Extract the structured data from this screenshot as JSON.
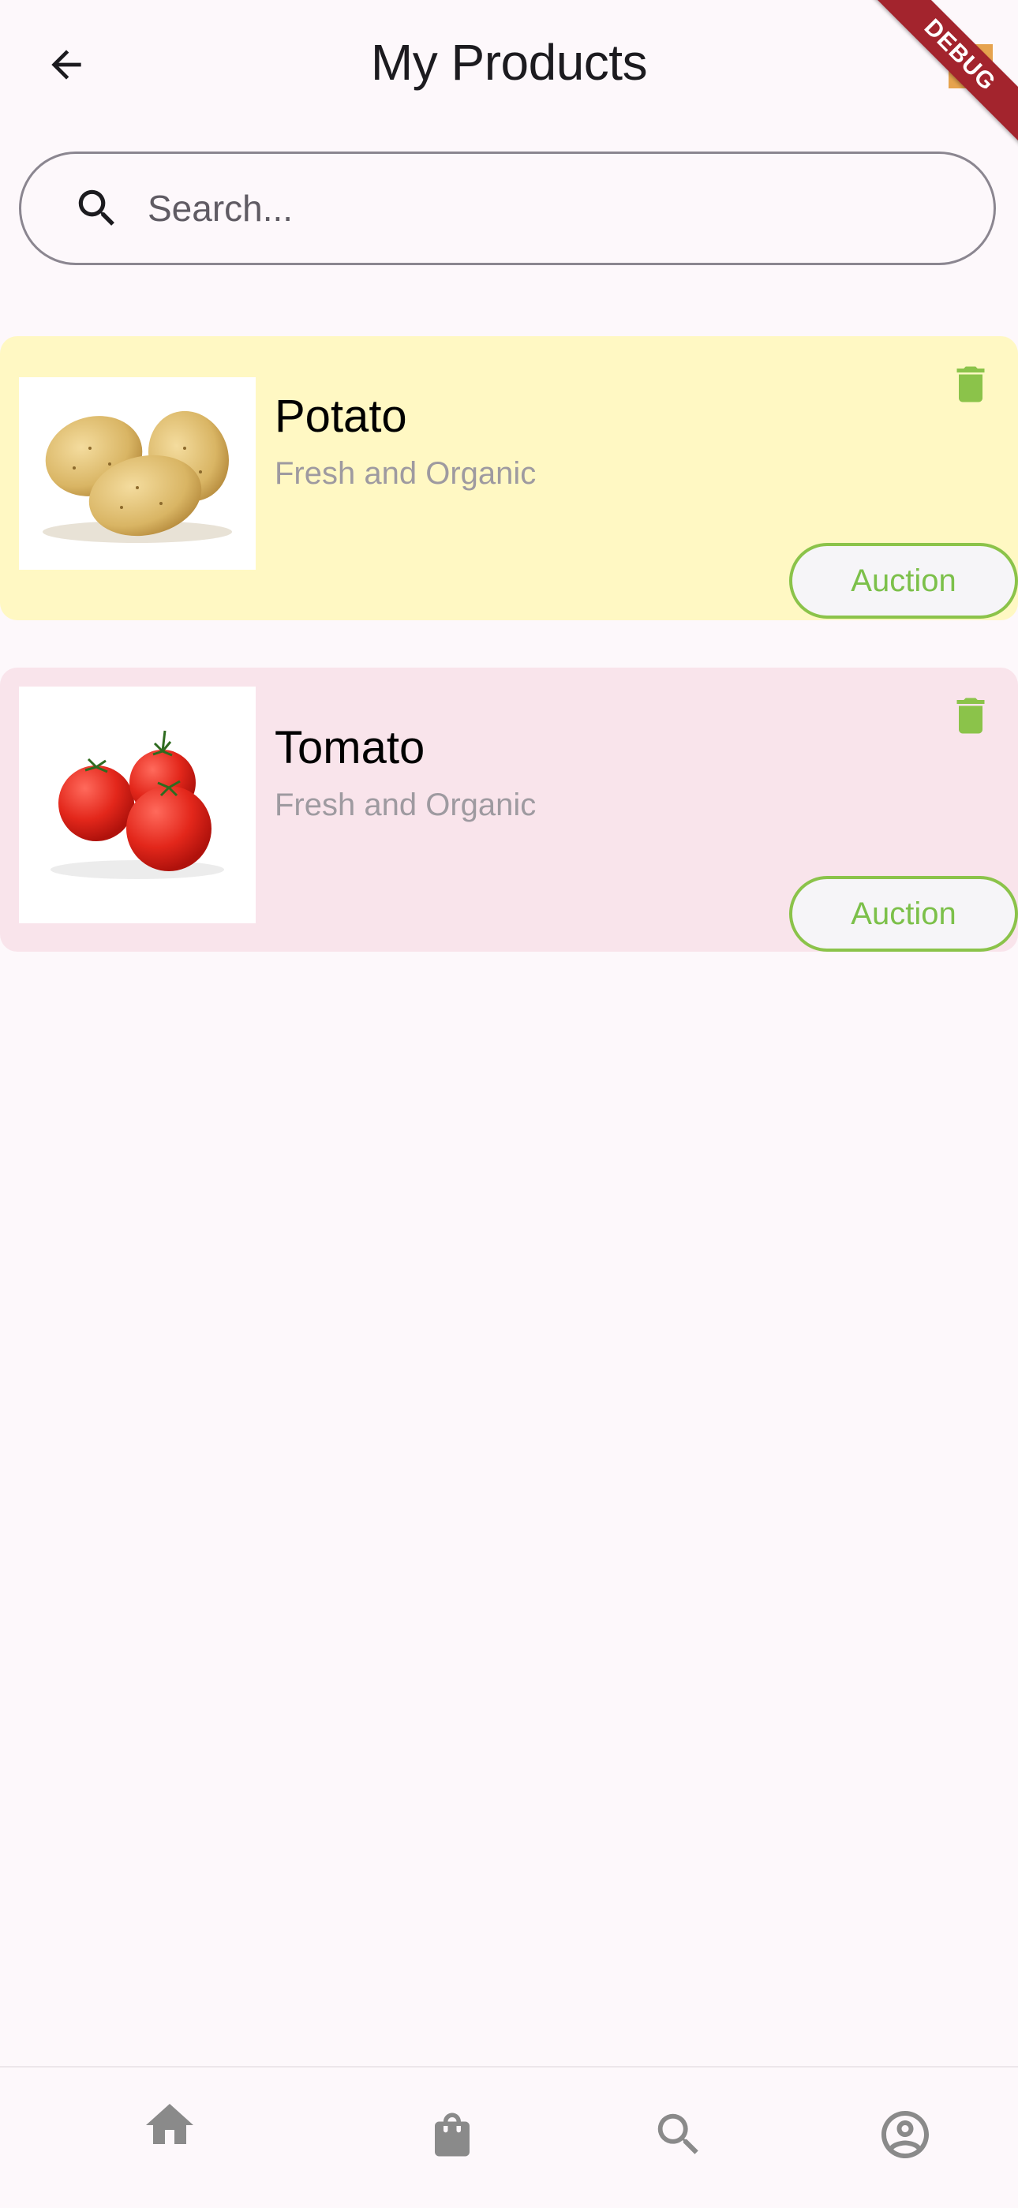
{
  "appbar": {
    "title": "My Products",
    "debug_label": "DEBUG"
  },
  "search": {
    "placeholder": "Search..."
  },
  "products": [
    {
      "name": "Potato",
      "subtitle": "Fresh and Organic",
      "auction_label": "Auction",
      "card_color": "#fff8c3"
    },
    {
      "name": "Tomato",
      "subtitle": "Fresh and Organic",
      "auction_label": "Auction",
      "card_color": "#f9e4eb"
    }
  ],
  "colors": {
    "accent_green": "#8bc34a",
    "icon_grey": "#8a8a8a"
  },
  "icons": {
    "back": "arrow-back-icon",
    "search": "search-icon",
    "delete": "trash-icon",
    "nav_home": "home-icon",
    "nav_bag": "shopping-bag-icon",
    "nav_search": "search-icon",
    "nav_profile": "account-circle-icon"
  }
}
